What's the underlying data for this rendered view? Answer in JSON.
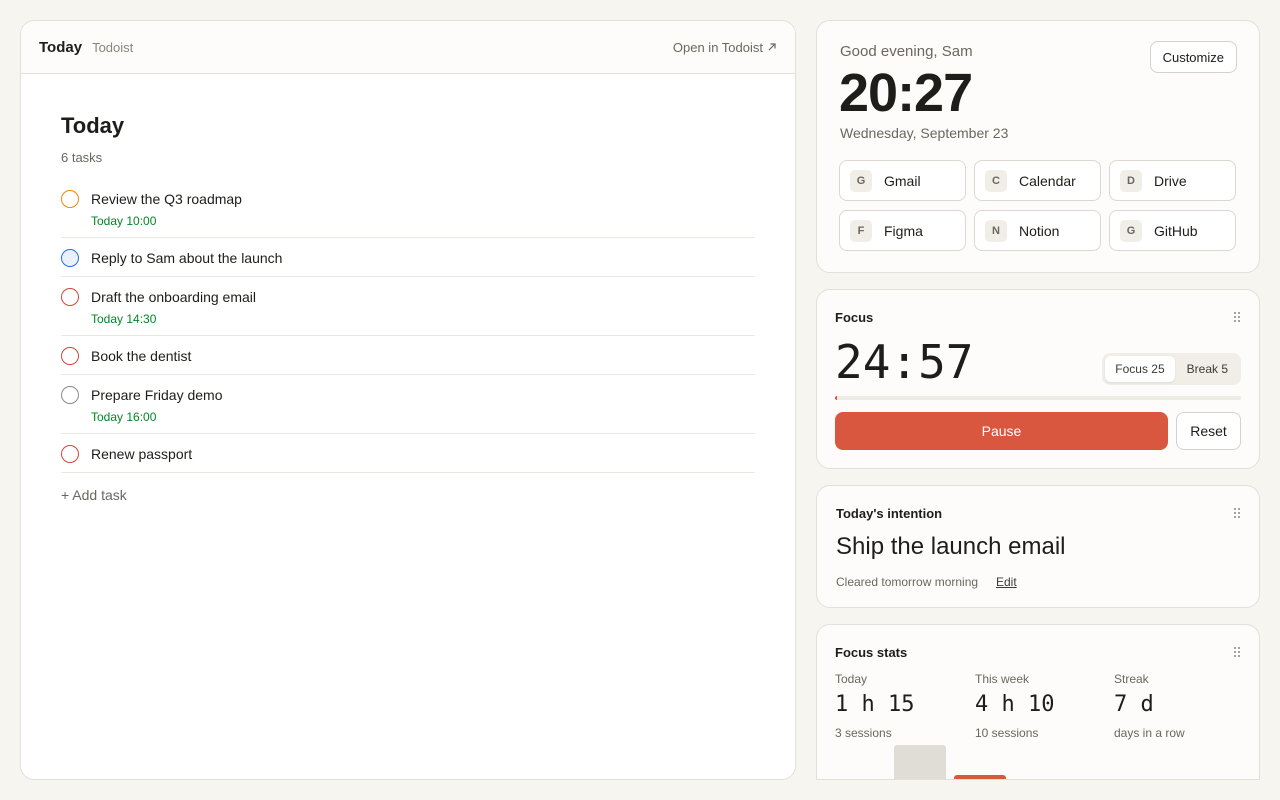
{
  "todo_panel": {
    "header_title": "Today",
    "header_app": "Todoist",
    "open_link": "Open in Todoist",
    "heading": "Today",
    "task_count": "6 tasks",
    "tasks": [
      {
        "name": "Review the Q3 roadmap",
        "due": "Today 10:00",
        "priority_color": "#eb8909"
      },
      {
        "name": "Reply to Sam about the launch",
        "due": "",
        "priority_color": "#246fe0"
      },
      {
        "name": "Draft the onboarding email",
        "due": "Today 14:30",
        "priority_color": "#d1453b"
      },
      {
        "name": "Book the dentist",
        "due": "",
        "priority_color": "#d1453b"
      },
      {
        "name": "Prepare Friday demo",
        "due": "Today 16:00",
        "priority_color": "#8a8a8a"
      },
      {
        "name": "Renew passport",
        "due": "",
        "priority_color": "#d1453b"
      }
    ],
    "add_task": "+ Add task"
  },
  "greeting": {
    "text": "Good evening, Sam",
    "time": "20:27",
    "date": "Wednesday, September 23",
    "customize": "Customize",
    "shortcuts": [
      {
        "letter": "G",
        "label": "Gmail"
      },
      {
        "letter": "C",
        "label": "Calendar"
      },
      {
        "letter": "D",
        "label": "Drive"
      },
      {
        "letter": "F",
        "label": "Figma"
      },
      {
        "letter": "N",
        "label": "Notion"
      },
      {
        "letter": "G",
        "label": "GitHub"
      }
    ]
  },
  "focus": {
    "title": "Focus",
    "timer": "24:57",
    "mode_focus": "Focus 25",
    "mode_break": "Break 5",
    "progress": 0.002,
    "pause": "Pause",
    "reset": "Reset"
  },
  "intention": {
    "title": "Today's intention",
    "text": "Ship the launch email",
    "sub": "Cleared tomorrow morning",
    "edit": "Edit"
  },
  "stats": {
    "title": "Focus stats",
    "today_label": "Today",
    "today_value": "1 h 15",
    "today_note": "3 sessions",
    "week_label": "This week",
    "week_value": "4 h 10",
    "week_note": "10 sessions",
    "streak_label": "Streak",
    "streak_value": "7 d",
    "streak_note": "days in a row"
  },
  "colors": {
    "accent": "#d9563f",
    "due_green": "#058527",
    "background": "#f7f5f0"
  }
}
